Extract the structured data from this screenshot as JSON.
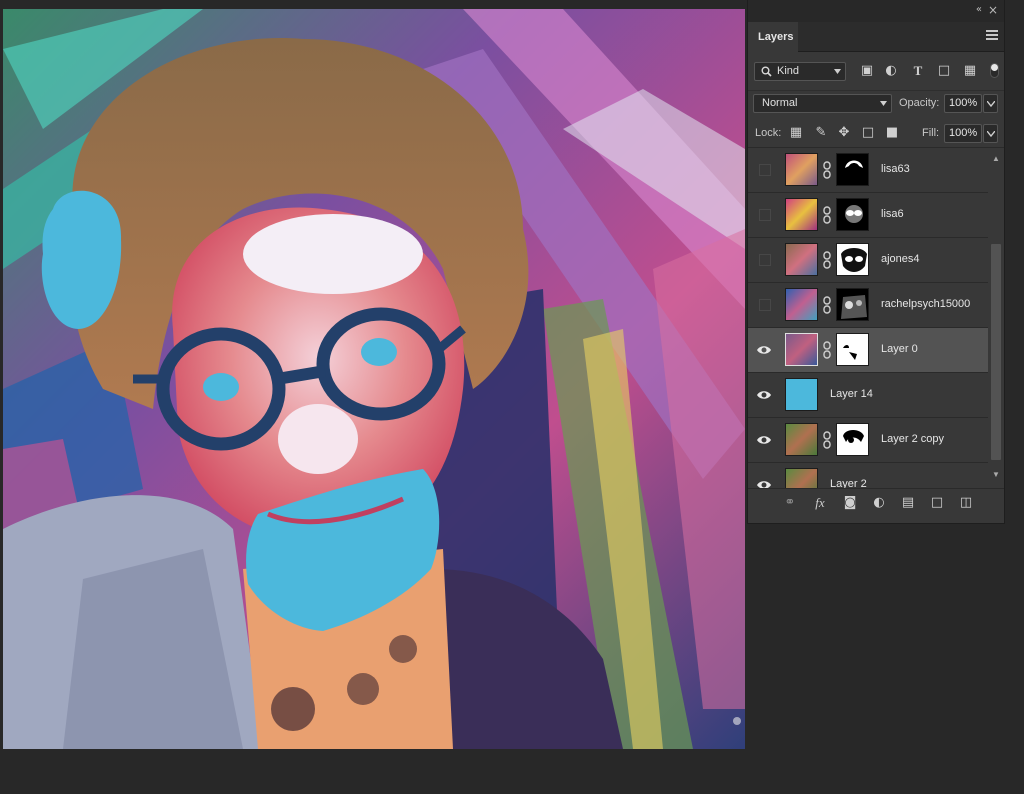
{
  "panel": {
    "tab_label": "Layers",
    "filter": {
      "kind_label": "Kind"
    },
    "blend_mode": "Normal",
    "opacity_label": "Opacity:",
    "opacity_value": "100%",
    "lock_label": "Lock:",
    "fill_label": "Fill:",
    "fill_value": "100%"
  },
  "layers": [
    {
      "name": "lisa63",
      "visible": false,
      "has_mask": true
    },
    {
      "name": "lisa6",
      "visible": false,
      "has_mask": true
    },
    {
      "name": "ajones4",
      "visible": false,
      "has_mask": true
    },
    {
      "name": "rachelpsych15000",
      "visible": false,
      "has_mask": true
    },
    {
      "name": "Layer 0",
      "visible": true,
      "has_mask": true,
      "selected": true
    },
    {
      "name": "Layer 14",
      "visible": true,
      "has_mask": false,
      "fill_color": "#4cb8dc"
    },
    {
      "name": "Layer 2 copy",
      "visible": true,
      "has_mask": true
    },
    {
      "name": "Layer 2",
      "visible": true,
      "has_mask": false
    }
  ],
  "colors": {
    "panel_bg": "#383838",
    "selected_layer": "#535353",
    "layer14_fill": "#4cb8dc",
    "app_bg": "#282828"
  },
  "icons": {
    "filter_icons": [
      "image-filter-icon",
      "adjustment-filter-icon",
      "type-filter-icon",
      "shape-filter-icon",
      "smart-object-filter-icon"
    ],
    "lock_icons": [
      "lock-transparent-pixels-icon",
      "lock-image-pixels-icon",
      "lock-position-icon",
      "lock-artboard-icon",
      "lock-all-icon"
    ],
    "footer_icons": [
      "link-layers-icon",
      "fx-icon",
      "add-mask-icon",
      "adjustment-layer-icon",
      "new-group-icon",
      "new-layer-icon",
      "delete-layer-icon"
    ]
  }
}
